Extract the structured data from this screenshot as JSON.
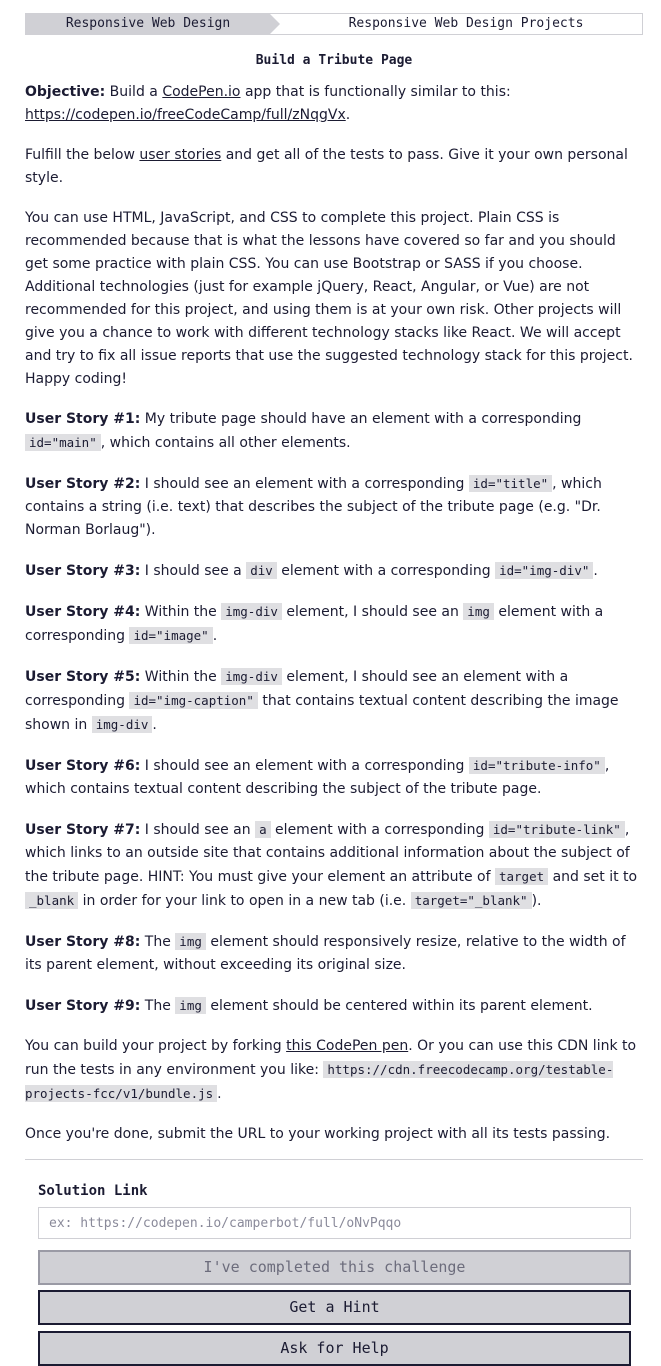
{
  "breadcrumb": {
    "section": "Responsive Web Design",
    "subsection": "Responsive Web Design Projects"
  },
  "title": "Build a Tribute Page",
  "objective": {
    "label": "Objective:",
    "text_1": " Build a ",
    "codepen_link": "CodePen.io",
    "text_2": " app that is functionally similar to this: ",
    "example_link": "https://codepen.io/freeCodeCamp/full/zNqgVx",
    "text_3": "."
  },
  "fulfill": {
    "text_1": "Fulfill the below ",
    "link": "user stories",
    "text_2": " and get all of the tests to pass. Give it your own personal style."
  },
  "tech_paragraph": "You can use HTML, JavaScript, and CSS to complete this project. Plain CSS is recommended because that is what the lessons have covered so far and you should get some practice with plain CSS. You can use Bootstrap or SASS if you choose. Additional technologies (just for example jQuery, React, Angular, or Vue) are not recommended for this project, and using them is at your own risk. Other projects will give you a chance to work with different technology stacks like React. We will accept and try to fix all issue reports that use the suggested technology stack for this project. Happy coding!",
  "stories": {
    "s1": {
      "label": "User Story #1:",
      "t1": " My tribute page should have an element with a corresponding ",
      "c1": "id=\"main\"",
      "t2": ", which contains all other elements."
    },
    "s2": {
      "label": "User Story #2:",
      "t1": " I should see an element with a corresponding ",
      "c1": "id=\"title\"",
      "t2": ", which contains a string (i.e. text) that describes the subject of the tribute page (e.g. \"Dr. Norman Borlaug\")."
    },
    "s3": {
      "label": "User Story #3:",
      "t1": " I should see a ",
      "c1": "div",
      "t2": " element with a corresponding ",
      "c2": "id=\"img-div\"",
      "t3": "."
    },
    "s4": {
      "label": "User Story #4:",
      "t1": " Within the ",
      "c1": "img-div",
      "t2": " element, I should see an ",
      "c2": "img",
      "t3": " element with a corresponding ",
      "c3": "id=\"image\"",
      "t4": "."
    },
    "s5": {
      "label": "User Story #5:",
      "t1": " Within the ",
      "c1": "img-div",
      "t2": " element, I should see an element with a corresponding ",
      "c2": "id=\"img-caption\"",
      "t3": " that contains textual content describing the image shown in ",
      "c3": "img-div",
      "t4": "."
    },
    "s6": {
      "label": "User Story #6:",
      "t1": " I should see an element with a corresponding ",
      "c1": "id=\"tribute-info\"",
      "t2": ", which contains textual content describing the subject of the tribute page."
    },
    "s7": {
      "label": "User Story #7:",
      "t1": " I should see an ",
      "c1": "a",
      "t2": " element with a corresponding ",
      "c2": "id=\"tribute-link\"",
      "t3": ", which links to an outside site that contains additional information about the subject of the tribute page. HINT: You must give your element an attribute of ",
      "c3": "target",
      "t4": " and set it to ",
      "c4": "_blank",
      "t5": " in order for your link to open in a new tab (i.e. ",
      "c5": "target=\"_blank\"",
      "t6": ")."
    },
    "s8": {
      "label": "User Story #8:",
      "t1": " The ",
      "c1": "img",
      "t2": " element should responsively resize, relative to the width of its parent element, without exceeding its original size."
    },
    "s9": {
      "label": "User Story #9:",
      "t1": " The ",
      "c1": "img",
      "t2": " element should be centered within its parent element."
    }
  },
  "build": {
    "t1": "You can build your project by forking ",
    "link": "this CodePen pen",
    "t2": ". Or you can use this CDN link to run the tests in any environment you like: ",
    "cdn": "https://cdn.freecodecamp.org/testable-projects-fcc/v1/bundle.js",
    "t3": "."
  },
  "submit_text": "Once you're done, submit the URL to your working project with all its tests passing.",
  "form": {
    "label": "Solution Link",
    "placeholder": "ex: https://codepen.io/camperbot/full/oNvPqqo",
    "completed_button": "I've completed this challenge",
    "hint_button": "Get a Hint",
    "help_button": "Ask for Help"
  }
}
